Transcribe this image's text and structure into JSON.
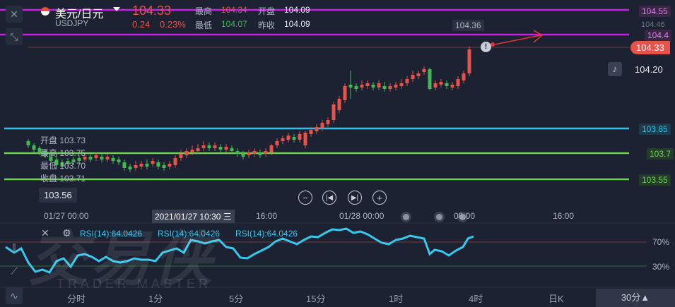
{
  "header": {
    "pair_name": "美元/日元",
    "symbol": "USDJPY",
    "price": "104.33",
    "change": "0.24",
    "change_pct": "0.23%",
    "high_label": "最高",
    "high": "104.34",
    "open_label": "开盘",
    "open": "104.09",
    "low_label": "最低",
    "low": "104.07",
    "prevclose_label": "昨收",
    "prevclose": "104.09"
  },
  "price_tags": {
    "line_magenta_top": "104.55",
    "level_104_46": "104.46",
    "line_magenta_2": "104.4",
    "current": "104.33",
    "alert": "104.20",
    "line_cyan": "103.85",
    "line_green_1": "103.7",
    "line_green_2": "103.55",
    "peak_label": "104.36",
    "low_tag": "103.56"
  },
  "ohlc_overlay": {
    "open_label": "开盘",
    "open": "103.73",
    "high_label": "最高",
    "high": "103.75",
    "low_label": "最低",
    "low": "103.70",
    "close_label": "收盘",
    "close": "103.71"
  },
  "controls": {
    "zoom_out": "−",
    "prev": "⏮",
    "next": "⏭",
    "zoom_in": "+"
  },
  "time_axis": {
    "t1": "01/27 00:00",
    "crosshair": "2021/01/27 10:30 三",
    "t2": "16:00",
    "t3": "01/28 00:00",
    "t4": "08:00",
    "t5": "16:00"
  },
  "rsi": {
    "label1": "RSI(14):64.0426",
    "label2": "RSI(14):64.0426",
    "label3": "RSI(14):64.0426",
    "level_high": "70%",
    "level_low": "30%"
  },
  "watermark": {
    "cn": "交易侠",
    "en": "TRADER MASTER"
  },
  "timeframes": [
    {
      "label": "分时"
    },
    {
      "label": "1分"
    },
    {
      "label": "5分"
    },
    {
      "label": "15分"
    },
    {
      "label": "1时"
    },
    {
      "label": "4时"
    },
    {
      "label": "日K"
    },
    {
      "label": "30分▲"
    }
  ],
  "colors": {
    "up": "#e5534b",
    "down": "#3fb950",
    "magenta": "#c81ee6",
    "cyan": "#2bc3e8",
    "green": "#6bd34a",
    "rsi": "#37c8ee"
  }
}
